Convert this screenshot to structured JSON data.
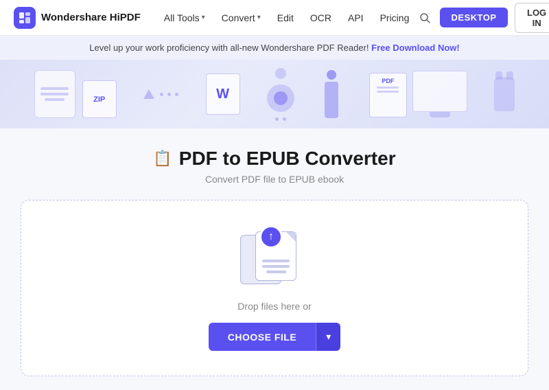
{
  "brand": {
    "name": "Wondershare HiPDF"
  },
  "navbar": {
    "links": [
      {
        "label": "All Tools",
        "hasDropdown": true
      },
      {
        "label": "Convert",
        "hasDropdown": true
      },
      {
        "label": "Edit",
        "hasDropdown": false
      },
      {
        "label": "OCR",
        "hasDropdown": false
      },
      {
        "label": "API",
        "hasDropdown": false
      },
      {
        "label": "Pricing",
        "hasDropdown": false
      }
    ],
    "desktop_btn": "DESKTOP",
    "login_btn": "LOG IN"
  },
  "promo": {
    "text": "Level up your work proficiency with all-new Wondershare PDF Reader!",
    "cta": "Free Download Now!"
  },
  "page": {
    "icon": "📋",
    "title": "PDF to EPUB Converter",
    "subtitle": "Convert PDF file to EPUB ebook"
  },
  "dropzone": {
    "drop_text": "Drop files here or",
    "choose_file_label": "CHOOSE FILE",
    "choose_dropdown_icon": "▾"
  }
}
